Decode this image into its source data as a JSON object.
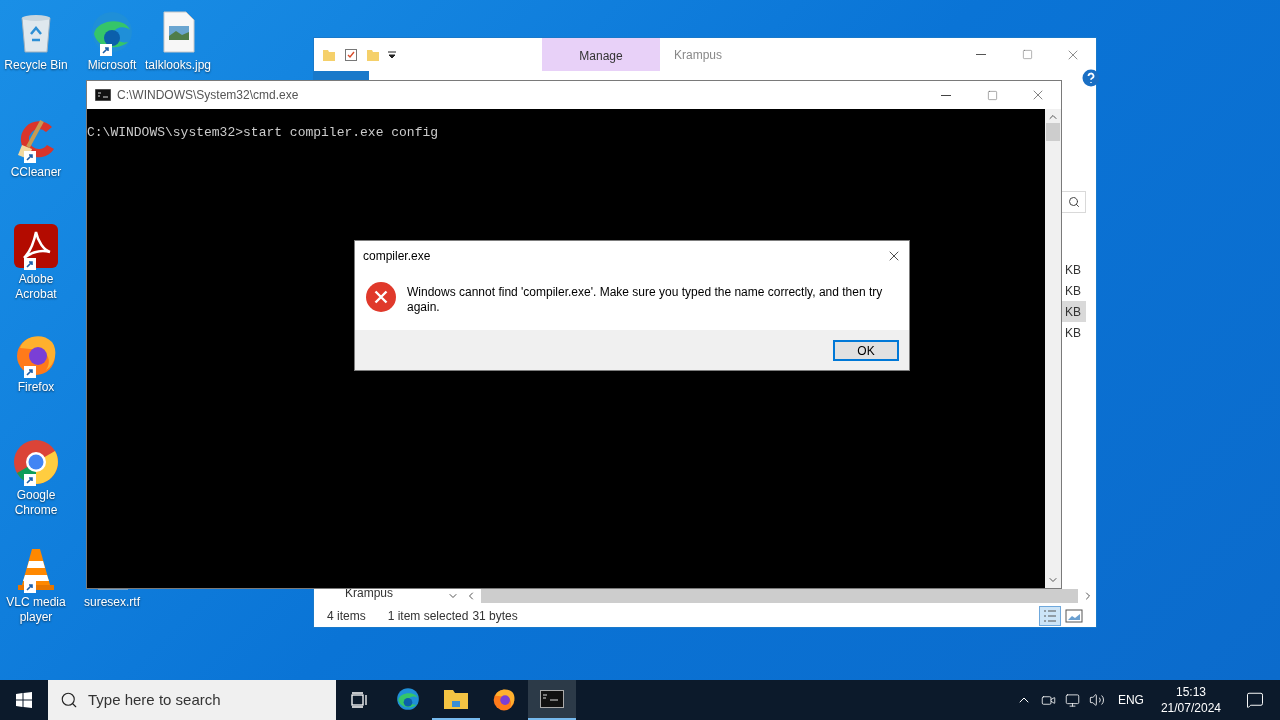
{
  "desktop_icons": [
    {
      "kind": "recycle-bin",
      "label": "Recycle Bin"
    },
    {
      "kind": "edge",
      "label": "Microsoft"
    },
    {
      "kind": "image-file",
      "label": "talklooks.jpg"
    },
    {
      "kind": "ccleaner",
      "label": "CCleaner"
    },
    {
      "kind": "acrobat",
      "label": "Adobe Acrobat"
    },
    {
      "kind": "firefox",
      "label": "Firefox"
    },
    {
      "kind": "chrome",
      "label": "Google Chrome"
    },
    {
      "kind": "vlc",
      "label": "VLC media player"
    },
    {
      "kind": "document-file",
      "label": "suresex.rtf"
    }
  ],
  "explorer": {
    "title": "Krampus",
    "context_tab": "Manage",
    "size_cells": [
      {
        "text": "KB",
        "selected": false
      },
      {
        "text": "KB",
        "selected": false
      },
      {
        "text": "KB",
        "selected": true
      },
      {
        "text": "KB",
        "selected": false
      }
    ],
    "nav_item": "Krampus",
    "status_bar": [
      "4 items",
      "1 item selected",
      "31 bytes"
    ]
  },
  "cmd": {
    "title": "C:\\WINDOWS\\System32\\cmd.exe",
    "lines": [
      "C:\\WINDOWS\\system32>start compiler.exe config"
    ]
  },
  "dialog": {
    "title": "compiler.exe",
    "message": "Windows cannot find 'compiler.exe'. Make sure you typed the name correctly, and then try again.",
    "buttons": [
      {
        "label": "OK",
        "default": true
      }
    ]
  },
  "taskbar": {
    "search_placeholder": "Type here to search",
    "apps": [
      {
        "kind": "edge",
        "running": false,
        "active": false
      },
      {
        "kind": "file-explorer",
        "running": true,
        "active": false
      },
      {
        "kind": "firefox",
        "running": false,
        "active": false
      },
      {
        "kind": "cmd",
        "running": true,
        "active": true
      }
    ],
    "language": "ENG",
    "time": "15:13",
    "date": "21/07/2024"
  }
}
